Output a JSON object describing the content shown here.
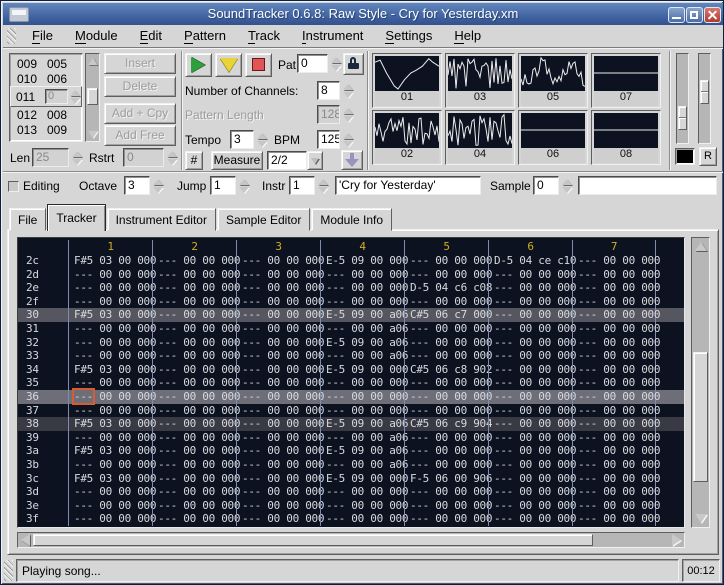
{
  "window": {
    "title": "SoundTracker 0.6.8: Raw Style - Cry for Yesterday.xm"
  },
  "menu": {
    "items": [
      {
        "label": "File",
        "accel": "F"
      },
      {
        "label": "Module",
        "accel": "M"
      },
      {
        "label": "Edit",
        "accel": "E"
      },
      {
        "label": "Pattern",
        "accel": "P"
      },
      {
        "label": "Track",
        "accel": "T"
      },
      {
        "label": "Instrument",
        "accel": "I"
      },
      {
        "label": "Settings",
        "accel": "S"
      },
      {
        "label": "Help",
        "accel": "H"
      }
    ]
  },
  "songlist": {
    "rows": [
      {
        "pos": "009",
        "pat": "005"
      },
      {
        "pos": "010",
        "pat": "006"
      },
      {
        "pos": "011",
        "value": "0",
        "current": true
      },
      {
        "pos": "012",
        "pat": "008"
      },
      {
        "pos": "013",
        "pat": "009"
      }
    ],
    "len_label": "Len",
    "len_value": "25",
    "rstrt_label": "Rstrt",
    "rstrt_value": "0"
  },
  "actions": {
    "insert": "Insert",
    "delete": "Delete",
    "add_copy": "Add + Cpy",
    "add_free": "Add Free"
  },
  "transport": {
    "pat_label": "Pat",
    "pat_value": "0",
    "channels_label": "Number of Channels:",
    "channels_value": "8",
    "pattern_length_label": "Pattern Length",
    "pattern_length_value": "128",
    "tempo_label": "Tempo",
    "tempo_value": "3",
    "bpm_label": "BPM",
    "bpm_value": "125",
    "hash_label": "#",
    "measure_label": "Measure",
    "measure_value": "2/2"
  },
  "scopes": [
    {
      "label": "01",
      "wave": "smooth"
    },
    {
      "label": "03",
      "wave": "noise"
    },
    {
      "label": "05",
      "wave": "wavy"
    },
    {
      "label": "07",
      "wave": "flat"
    },
    {
      "label": "02",
      "wave": "noise"
    },
    {
      "label": "04",
      "wave": "noise"
    },
    {
      "label": "06",
      "wave": "flat"
    },
    {
      "label": "08",
      "wave": "flat"
    }
  ],
  "right_controls": {
    "record_label": "R"
  },
  "edit_row": {
    "editing_label": "Editing",
    "octave_label": "Octave",
    "octave_value": "3",
    "jump_label": "Jump",
    "jump_value": "1",
    "instr_label": "Instr",
    "instr_value": "1",
    "song_title": "'Cry for Yesterday'",
    "sample_label": "Sample",
    "sample_value": "0",
    "sample_name": ""
  },
  "tabs": {
    "items": [
      "File",
      "Tracker",
      "Instrument Editor",
      "Sample Editor",
      "Module Info"
    ],
    "active": "Tracker"
  },
  "pattern": {
    "channel_headers": [
      "1",
      "2",
      "3",
      "4",
      "5",
      "6",
      "7"
    ],
    "cursor": {
      "row": "36",
      "channel": 0
    },
    "rows": [
      {
        "n": "2c",
        "hl": "",
        "c": [
          "F#5 03 00 000",
          "--- 00 00 000",
          "--- 00 00 000",
          "E-5 09 00 000",
          "--- 00 00 000",
          "D-5 04 ce c10",
          "--- 00 00 000"
        ]
      },
      {
        "n": "2d",
        "hl": "",
        "c": [
          "--- 00 00 000",
          "--- 00 00 000",
          "--- 00 00 000",
          "--- 00 00 000",
          "--- 00 00 000",
          "--- 00 00 000",
          "--- 00 00 000"
        ]
      },
      {
        "n": "2e",
        "hl": "",
        "c": [
          "--- 00 00 000",
          "--- 00 00 000",
          "--- 00 00 000",
          "--- 00 00 000",
          "D-5 04 c6 c08",
          "--- 00 00 000",
          "--- 00 00 000"
        ]
      },
      {
        "n": "2f",
        "hl": "",
        "c": [
          "--- 00 00 000",
          "--- 00 00 000",
          "--- 00 00 000",
          "--- 00 00 000",
          "--- 00 00 000",
          "--- 00 00 000",
          "--- 00 00 000"
        ]
      },
      {
        "n": "30",
        "hl": "major",
        "c": [
          "F#5 03 00 000",
          "--- 00 00 000",
          "--- 00 00 000",
          "E-5 09 00 a06",
          "C#5 06 c7 000",
          "--- 00 00 000",
          "--- 00 00 000"
        ]
      },
      {
        "n": "31",
        "hl": "",
        "c": [
          "--- 00 00 000",
          "--- 00 00 000",
          "--- 00 00 000",
          "--- 00 00 a06",
          "--- 00 00 000",
          "--- 00 00 000",
          "--- 00 00 000"
        ]
      },
      {
        "n": "32",
        "hl": "",
        "c": [
          "--- 00 00 000",
          "--- 00 00 000",
          "--- 00 00 000",
          "E-5 09 00 a06",
          "--- 00 00 000",
          "--- 00 00 000",
          "--- 00 00 000"
        ]
      },
      {
        "n": "33",
        "hl": "",
        "c": [
          "--- 00 00 000",
          "--- 00 00 000",
          "--- 00 00 000",
          "--- 00 00 a06",
          "--- 00 00 000",
          "--- 00 00 000",
          "--- 00 00 000"
        ]
      },
      {
        "n": "34",
        "hl": "",
        "c": [
          "F#5 03 00 000",
          "--- 00 00 000",
          "--- 00 00 000",
          "E-5 09 00 000",
          "C#5 06 c8 902",
          "--- 00 00 000",
          "--- 00 00 000"
        ]
      },
      {
        "n": "35",
        "hl": "",
        "c": [
          "--- 00 00 000",
          "--- 00 00 000",
          "--- 00 00 000",
          "--- 00 00 000",
          "--- 00 00 000",
          "--- 00 00 000",
          "--- 00 00 000"
        ]
      },
      {
        "n": "36",
        "hl": "cursor",
        "c": [
          "--- 00 00 000",
          "--- 00 00 000",
          "--- 00 00 000",
          "--- 00 00 000",
          "--- 00 00 000",
          "--- 00 00 000",
          "--- 00 00 000"
        ]
      },
      {
        "n": "37",
        "hl": "",
        "c": [
          "--- 00 00 000",
          "--- 00 00 000",
          "--- 00 00 000",
          "--- 00 00 000",
          "--- 00 00 000",
          "--- 00 00 000",
          "--- 00 00 000"
        ]
      },
      {
        "n": "38",
        "hl": "minor",
        "c": [
          "F#5 03 00 000",
          "--- 00 00 000",
          "--- 00 00 000",
          "E-5 09 00 a06",
          "C#5 06 c9 904",
          "--- 00 00 000",
          "--- 00 00 000"
        ]
      },
      {
        "n": "39",
        "hl": "",
        "c": [
          "--- 00 00 000",
          "--- 00 00 000",
          "--- 00 00 000",
          "--- 00 00 a06",
          "--- 00 00 000",
          "--- 00 00 000",
          "--- 00 00 000"
        ]
      },
      {
        "n": "3a",
        "hl": "",
        "c": [
          "F#5 03 00 000",
          "--- 00 00 000",
          "--- 00 00 000",
          "E-5 09 00 a06",
          "--- 00 00 000",
          "--- 00 00 000",
          "--- 00 00 000"
        ]
      },
      {
        "n": "3b",
        "hl": "",
        "c": [
          "--- 00 00 000",
          "--- 00 00 000",
          "--- 00 00 000",
          "--- 00 00 a06",
          "--- 00 00 000",
          "--- 00 00 000",
          "--- 00 00 000"
        ]
      },
      {
        "n": "3c",
        "hl": "",
        "c": [
          "F#5 03 00 000",
          "--- 00 00 000",
          "--- 00 00 000",
          "E-5 09 00 000",
          "F-5 06 00 906",
          "--- 00 00 000",
          "--- 00 00 000"
        ]
      },
      {
        "n": "3d",
        "hl": "",
        "c": [
          "--- 00 00 000",
          "--- 00 00 000",
          "--- 00 00 000",
          "--- 00 00 000",
          "--- 00 00 000",
          "--- 00 00 000",
          "--- 00 00 000"
        ]
      },
      {
        "n": "3e",
        "hl": "",
        "c": [
          "--- 00 00 000",
          "--- 00 00 000",
          "--- 00 00 000",
          "--- 00 00 000",
          "--- 00 00 000",
          "--- 00 00 000",
          "--- 00 00 000"
        ]
      },
      {
        "n": "3f",
        "hl": "",
        "c": [
          "--- 00 00 000",
          "--- 00 00 000",
          "--- 00 00 000",
          "--- 00 00 000",
          "--- 00 00 000",
          "--- 00 00 000",
          "--- 00 00 000"
        ]
      }
    ]
  },
  "statusbar": {
    "message": "Playing song...",
    "time": "00:12"
  },
  "colors": {
    "titlebar": "#3e5f9e",
    "panel": "#d6d6d6",
    "pattern_bg": "#0c1220",
    "pattern_text": "#d6dade",
    "channel_header": "#d4af1e",
    "separator": "#7e8bb0",
    "highlight_major": "#565660",
    "highlight_minor": "#3a3a44",
    "cursor_row": "#6e6e78",
    "cursor_box": "#d95b2e",
    "wave": "#ececec"
  }
}
